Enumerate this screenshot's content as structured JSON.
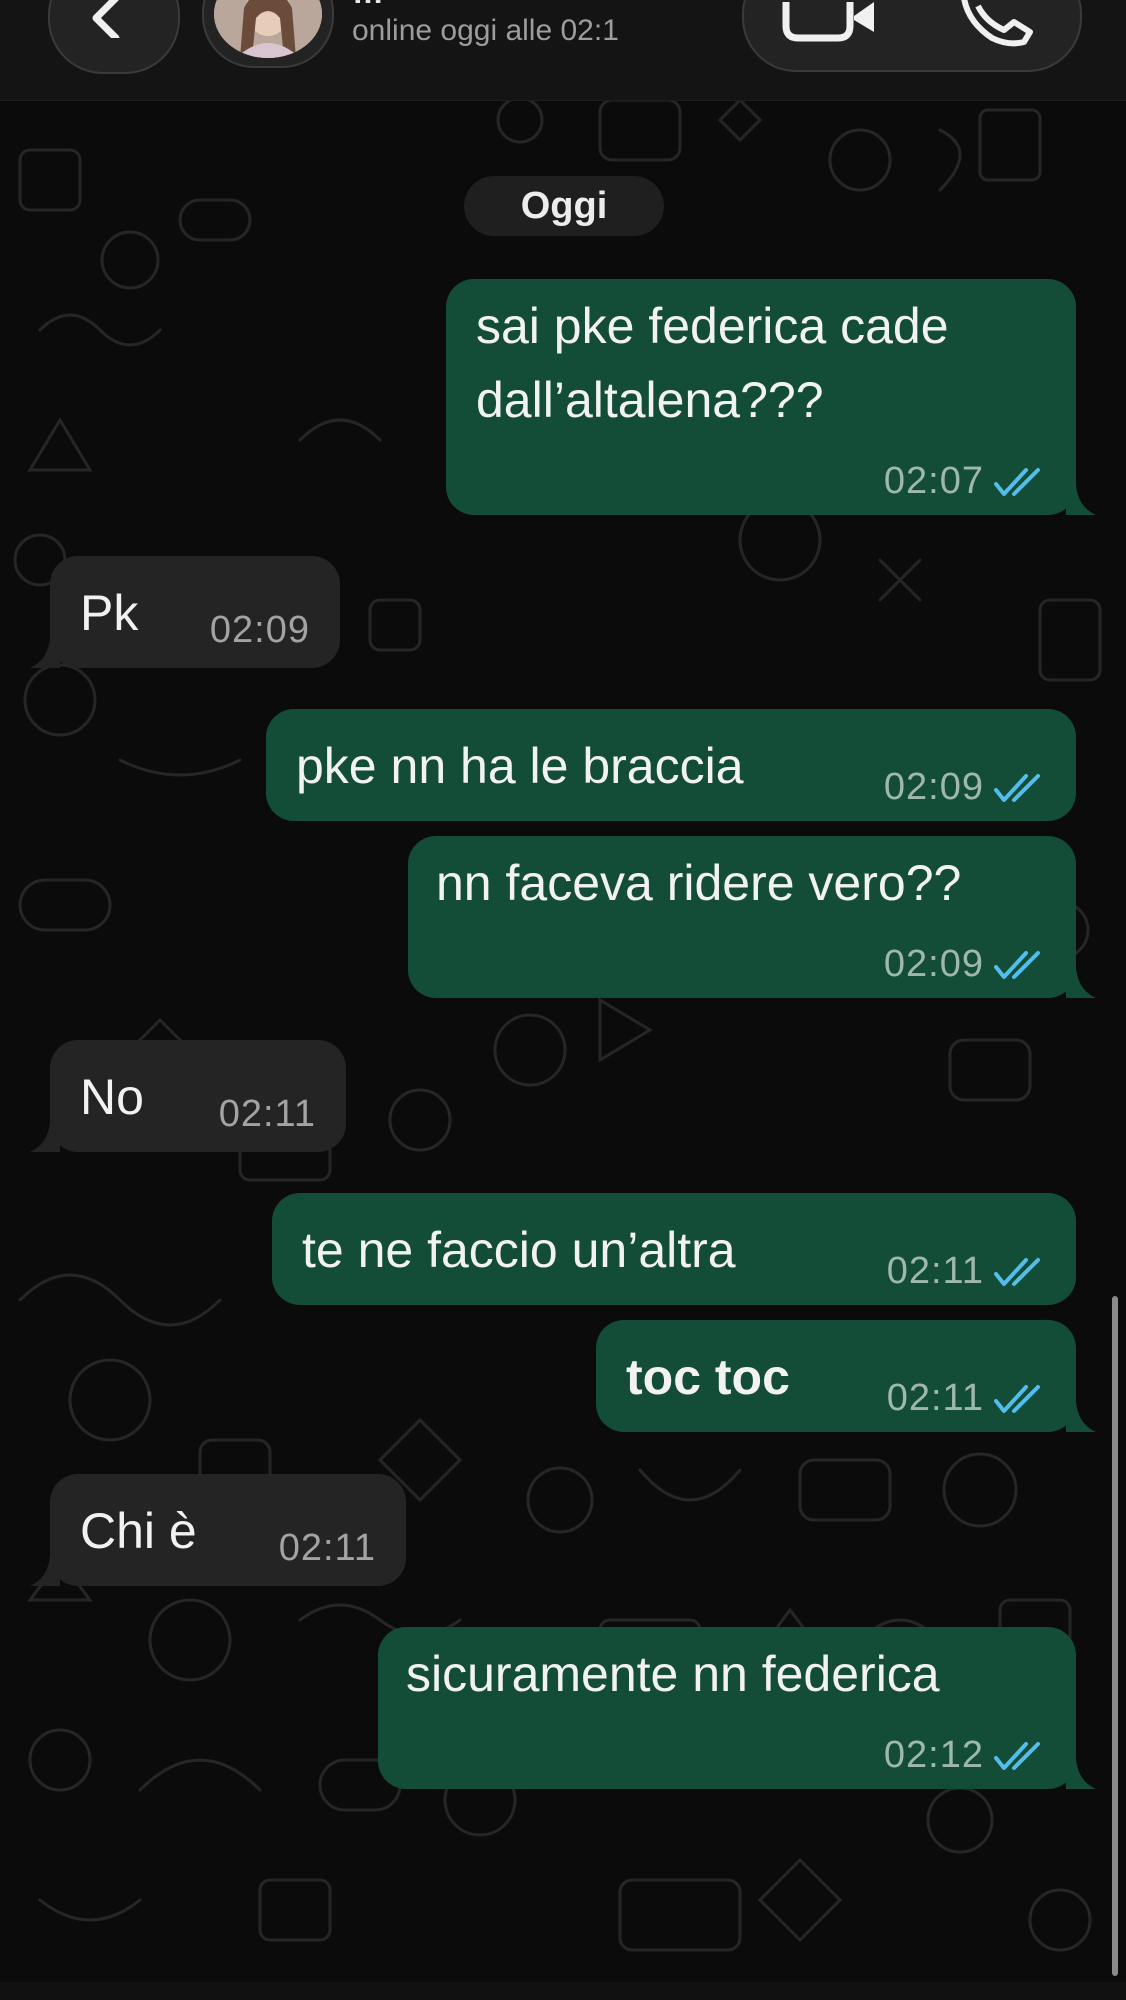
{
  "header": {
    "back_icon": "chevron-left-icon",
    "contact_name_fragment": "…",
    "status": "online oggi alle 02:1",
    "video_icon": "video-camera-icon",
    "call_icon": "phone-icon"
  },
  "chat": {
    "date_separator": "Oggi",
    "messages": [
      {
        "direction": "out",
        "text": [
          "sai pke federica cade",
          "dall’altalena???"
        ],
        "time": "02:07",
        "read": true
      },
      {
        "direction": "in",
        "text": [
          "Pk"
        ],
        "time": "02:09"
      },
      {
        "direction": "out",
        "text": [
          "pke nn ha le braccia"
        ],
        "time": "02:09",
        "read": true
      },
      {
        "direction": "out",
        "text": [
          "nn faceva ridere vero??"
        ],
        "time": "02:09",
        "read": true
      },
      {
        "direction": "in",
        "text": [
          "No"
        ],
        "time": "02:11"
      },
      {
        "direction": "out",
        "text": [
          "te ne faccio un’altra"
        ],
        "time": "02:11",
        "read": true
      },
      {
        "direction": "out",
        "text": [
          "toc toc"
        ],
        "time": "02:11",
        "read": true,
        "bold": true
      },
      {
        "direction": "in",
        "text": [
          "Chi è"
        ],
        "time": "02:11"
      },
      {
        "direction": "out",
        "text": [
          "sicuramente nn federica"
        ],
        "time": "02:12",
        "read": true
      }
    ]
  },
  "colors": {
    "outgoing_bubble": "#134d37",
    "incoming_bubble": "#242424",
    "read_ticks": "#53bdeb",
    "background": "#0b0b0b"
  }
}
